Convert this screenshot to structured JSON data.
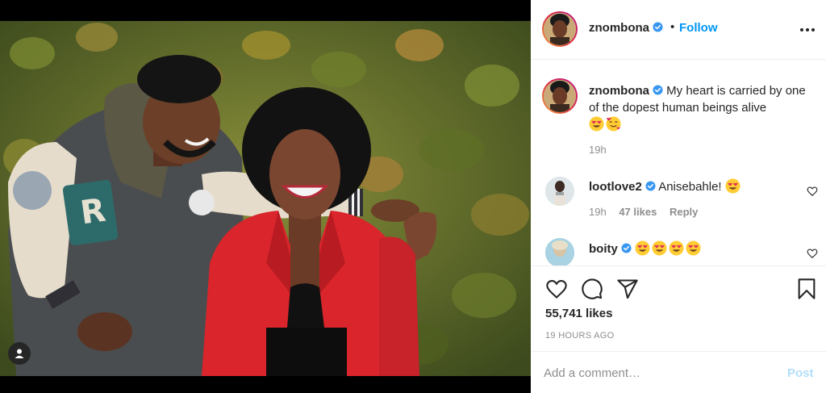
{
  "header": {
    "username": "znombona",
    "separator": "•",
    "follow_label": "Follow"
  },
  "caption": {
    "username": "znombona",
    "text": "My heart is carried by one of the dopest human beings alive",
    "emojis": [
      "heart-eyes-emoji",
      "smiling-face-with-hearts-emoji"
    ],
    "time": "19h"
  },
  "comments": [
    {
      "username": "lootlove2",
      "text": "Anisebahle!",
      "emojis": [
        "heart-eyes-emoji"
      ],
      "time": "19h",
      "likes": "47 likes",
      "reply_label": "Reply"
    },
    {
      "username": "boity",
      "text": "",
      "emojis": [
        "heart-eyes-emoji",
        "heart-eyes-emoji",
        "heart-eyes-emoji",
        "heart-eyes-emoji"
      ]
    }
  ],
  "stats": {
    "likes": "55,741 likes",
    "posted": "19 HOURS AGO"
  },
  "add_comment": {
    "placeholder": "Add a comment…",
    "post_label": "Post"
  },
  "colors": {
    "accent": "#0095f6",
    "verified": "#3897f0",
    "post_disabled": "#b2dffc",
    "jacket_red": "#d9252b"
  },
  "icons": [
    "verified-badge-icon",
    "more-options-icon",
    "heart-icon",
    "comment-icon",
    "share-icon",
    "save-bookmark-icon",
    "user-tag-icon"
  ]
}
